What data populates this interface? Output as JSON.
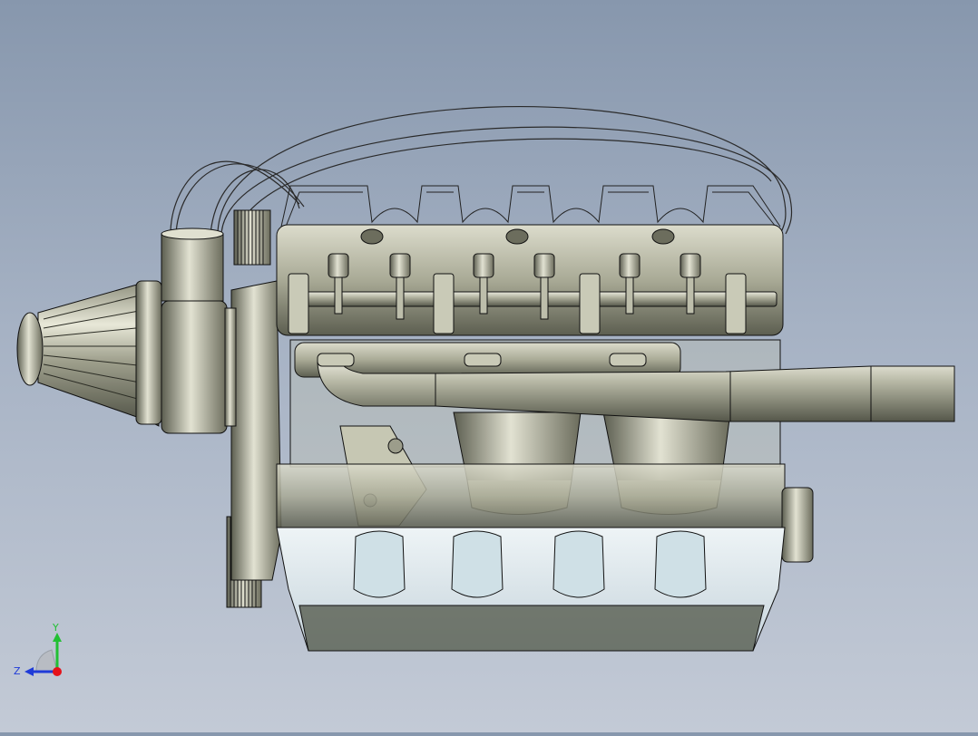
{
  "viewport": {
    "title": "",
    "background_top": "#8797ad",
    "background_bottom": "#c3cad6"
  },
  "model": {
    "name": "",
    "shade_color": "#c9cab7",
    "shade_dark": "#6e705f",
    "edge_color": "#1a1a1a",
    "glass_color": "#dfe9ee"
  },
  "triad": {
    "y_label": "Y",
    "z_label": "Z",
    "y_color": "#22c033",
    "z_color": "#1f3bd8",
    "x_color": "#e5121a"
  }
}
